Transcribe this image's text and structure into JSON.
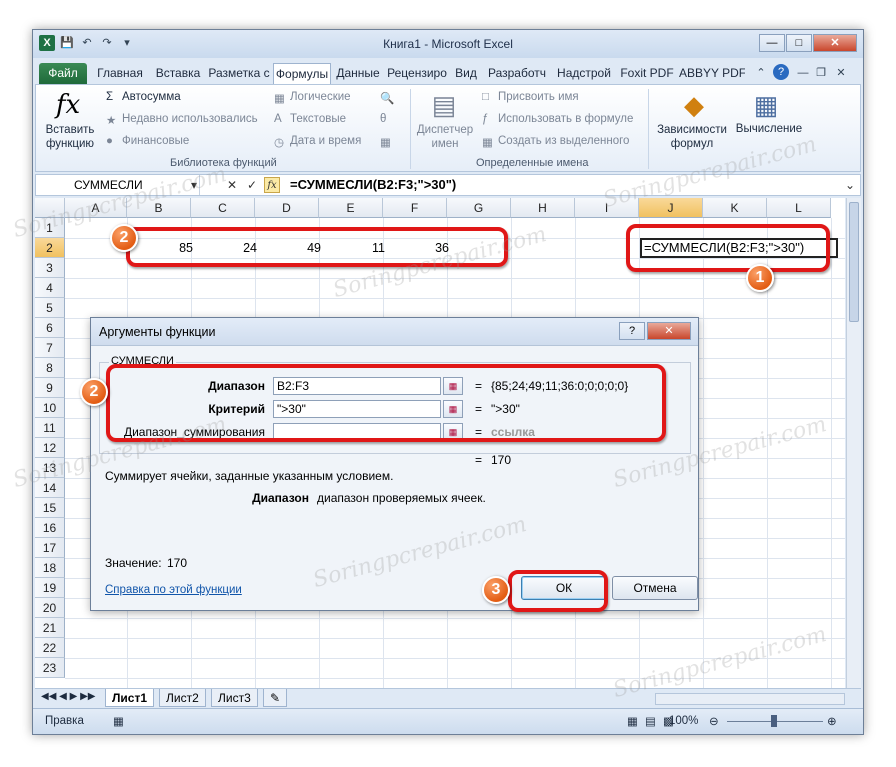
{
  "window": {
    "title": "Книга1  -  Microsoft Excel",
    "tabs": [
      "Файл",
      "Главная",
      "Вставка",
      "Разметка с",
      "Формулы",
      "Данные",
      "Рецензиро",
      "Вид",
      "Разработч",
      "Надстрой",
      "Foxit PDF",
      "ABBYY PDF"
    ],
    "selected_tab": "Формулы"
  },
  "ribbon": {
    "insert_function": "Вставить функцию",
    "autosum": "Автосумма",
    "recent": "Недавно использовались",
    "financial": "Финансовые",
    "logical": "Логические",
    "text": "Текстовые",
    "datetime": "Дата и время",
    "name_manager": "Диспетчер имен",
    "define_name": "Присвоить имя",
    "use_in_formula": "Использовать в формуле",
    "create_from_sel": "Создать из выделенного",
    "trace": "Зависимости формул",
    "calculation": "Вычисление",
    "group_library": "Библиотека функций",
    "group_names": "Определенные имена"
  },
  "formula_bar": {
    "name_box": "СУММЕСЛИ",
    "formula": "=СУММЕСЛИ(B2:F3;\">30\")",
    "fx": "fx"
  },
  "sheet": {
    "columns": [
      "A",
      "B",
      "C",
      "D",
      "E",
      "F",
      "G",
      "H",
      "I",
      "J",
      "K",
      "L"
    ],
    "rows": [
      "1",
      "2",
      "3",
      "4",
      "5",
      "6",
      "7",
      "8",
      "9",
      "10",
      "11",
      "12",
      "13",
      "14",
      "15",
      "16",
      "17",
      "18",
      "19",
      "20",
      "21",
      "22",
      "23"
    ],
    "row2_values": [
      "85",
      "24",
      "49",
      "11",
      "36"
    ],
    "active_cell_text": "=СУММЕСЛИ(B2:F3;\">30\")"
  },
  "dialog": {
    "title": "Аргументы функции",
    "function_name": "СУММЕСЛИ",
    "args": [
      {
        "label": "Диапазон",
        "value": "B2:F3",
        "result": "{85;24;49;11;36:0;0;0;0;0}",
        "bold": true
      },
      {
        "label": "Критерий",
        "value": "\">30\"",
        "result": "\">30\"",
        "bold": true
      },
      {
        "label": "Диапазон_суммирования",
        "value": "",
        "result": "ссылка",
        "bold": false
      }
    ],
    "total": "170",
    "description": "Суммирует ячейки, заданные указанным условием.",
    "arg_help_name": "Диапазон",
    "arg_help_text": "диапазон проверяемых ячеек.",
    "value_label": "Значение:",
    "value": "170",
    "help_link": "Справка по этой функции",
    "ok": "ОК",
    "cancel": "Отмена"
  },
  "sheet_tabs": [
    "Лист1",
    "Лист2",
    "Лист3"
  ],
  "status": {
    "mode": "Правка",
    "zoom": "100%"
  },
  "callouts": [
    "1",
    "2",
    "2",
    "3"
  ],
  "watermark": "Soringpcrepair.com",
  "colors": {
    "accent_red": "#e01717",
    "badge_orange": "#e35d14",
    "excel_green": "#1e7145"
  }
}
